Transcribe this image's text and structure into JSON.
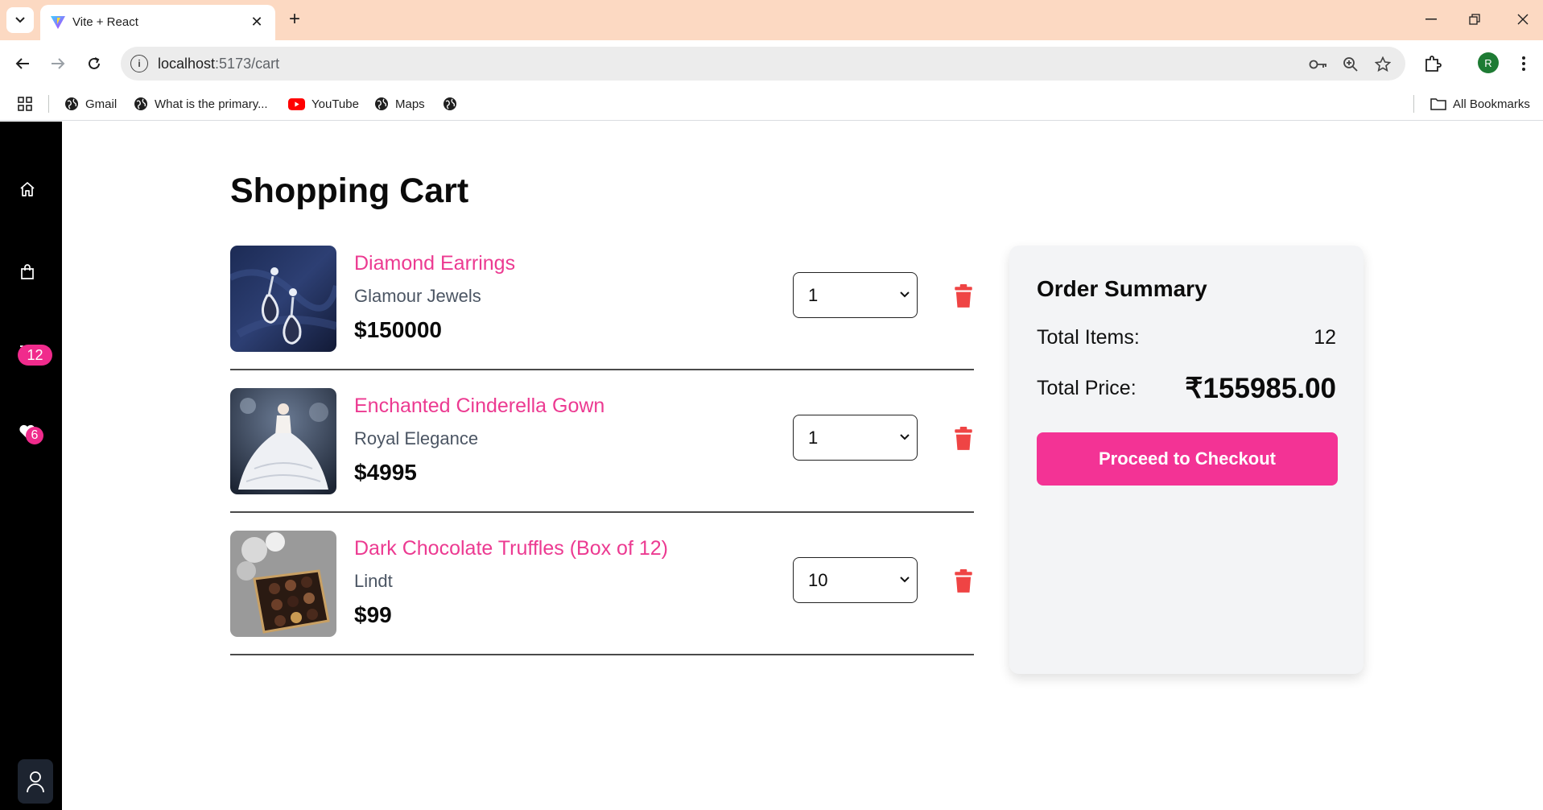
{
  "browser": {
    "tab_title": "Vite + React",
    "url_host": "localhost",
    "url_rest": ":5173/cart",
    "profile_initial": "R",
    "bookmarks": [
      {
        "label": "Gmail",
        "icon": "globe-icon"
      },
      {
        "label": "What is the primary...",
        "icon": "globe-icon"
      },
      {
        "label": "YouTube",
        "icon": "youtube-icon"
      },
      {
        "label": "Maps",
        "icon": "globe-icon"
      },
      {
        "label": "",
        "icon": "globe-icon"
      }
    ],
    "all_bookmarks_label": "All Bookmarks"
  },
  "sidebar": {
    "cart_count": "12",
    "wishlist_count": "6",
    "icons": [
      "home-icon",
      "shopping-bag-icon",
      "cart-icon",
      "heart-icon",
      "user-icon"
    ]
  },
  "page": {
    "title": "Shopping Cart"
  },
  "cart": {
    "items": [
      {
        "name": "Diamond Earrings",
        "brand": "Glamour Jewels",
        "price": "$150000",
        "quantity": "1"
      },
      {
        "name": "Enchanted Cinderella Gown",
        "brand": "Royal Elegance",
        "price": "$4995",
        "quantity": "1"
      },
      {
        "name": "Dark Chocolate Truffles (Box of 12)",
        "brand": "Lindt",
        "price": "$99",
        "quantity": "10"
      }
    ]
  },
  "summary": {
    "title": "Order Summary",
    "items_label": "Total Items:",
    "items_value": "12",
    "price_label": "Total Price:",
    "price_value": "₹155985.00",
    "checkout_label": "Proceed to Checkout"
  },
  "colors": {
    "accent": "#f33395",
    "product_name": "#ec3a91",
    "delete": "#ef4444",
    "sidebar": "#000000",
    "tab_strip": "#fcd9c2"
  }
}
